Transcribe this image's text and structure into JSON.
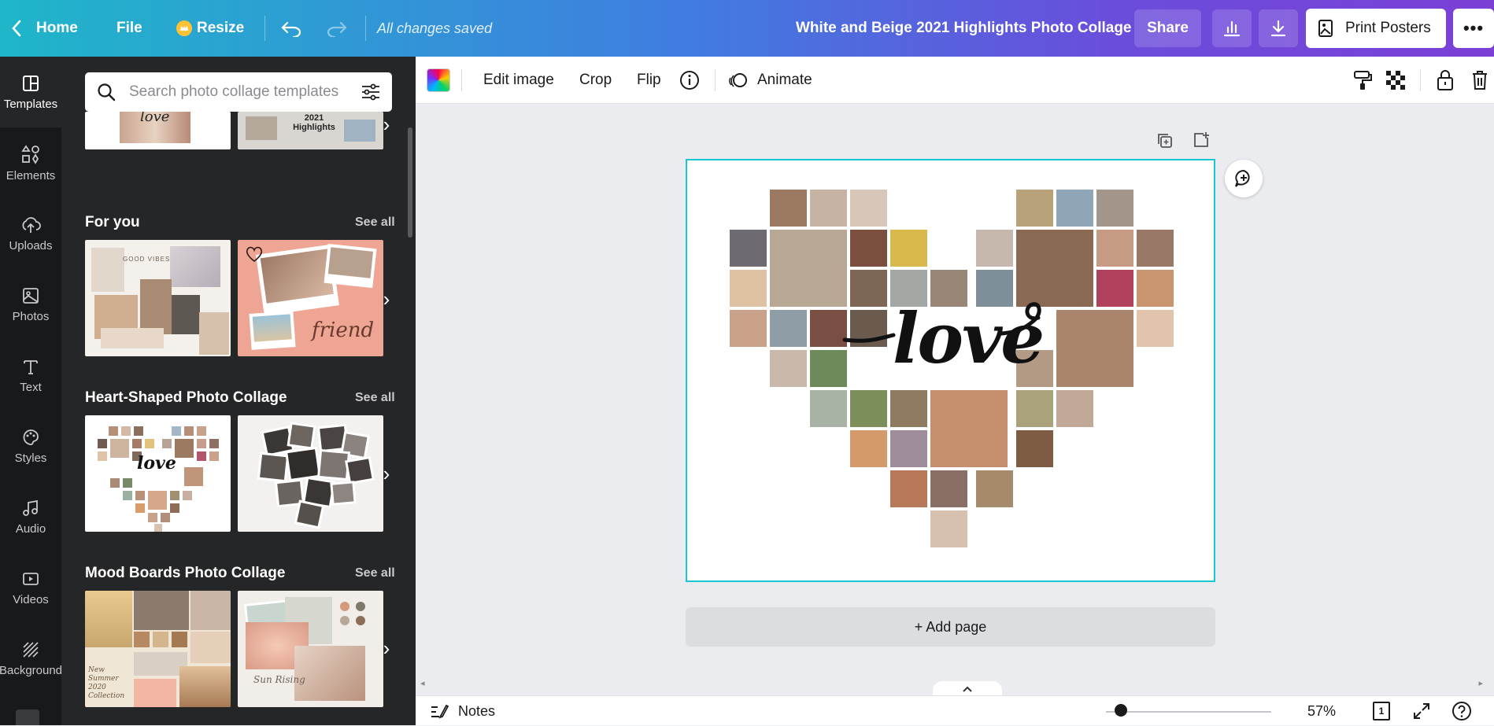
{
  "topbar": {
    "home_label": "Home",
    "file_label": "File",
    "resize_label": "Resize",
    "status": "All changes saved",
    "doc_title": "White and Beige 2021 Highlights Photo Collage",
    "share_label": "Share",
    "print_label": "Print Posters",
    "more_label": "•••"
  },
  "rail": [
    {
      "label": "Templates",
      "icon": "templates-icon"
    },
    {
      "label": "Elements",
      "icon": "elements-icon"
    },
    {
      "label": "Uploads",
      "icon": "uploads-icon"
    },
    {
      "label": "Photos",
      "icon": "photos-icon"
    },
    {
      "label": "Text",
      "icon": "text-icon"
    },
    {
      "label": "Styles",
      "icon": "styles-icon"
    },
    {
      "label": "Audio",
      "icon": "audio-icon"
    },
    {
      "label": "Videos",
      "icon": "videos-icon"
    },
    {
      "label": "Background",
      "icon": "background-icon"
    }
  ],
  "panel": {
    "search_placeholder": "Search photo collage templates",
    "see_all": "See all",
    "sections": [
      {
        "title": "For you"
      },
      {
        "title": "Heart-Shaped Photo Collage"
      },
      {
        "title": "Mood Boards Photo Collage"
      }
    ],
    "thumb_text": {
      "highlights": "2021 Highlights",
      "good_vibes": "GOOD VIBES",
      "friend": "friend",
      "love": "love",
      "new_summer": "New Summer 2020 Collection",
      "sun_rising": "Sun Rising"
    }
  },
  "toolbar": {
    "edit_image": "Edit image",
    "crop": "Crop",
    "flip": "Flip",
    "animate": "Animate"
  },
  "canvas": {
    "love_text": "love",
    "add_page": "+ Add page"
  },
  "bottombar": {
    "notes": "Notes",
    "zoom": "57%",
    "page_count": "1"
  },
  "colors": {
    "accent": "#19c6d3",
    "rail_bg": "#18191b",
    "panel_bg": "#252627"
  }
}
